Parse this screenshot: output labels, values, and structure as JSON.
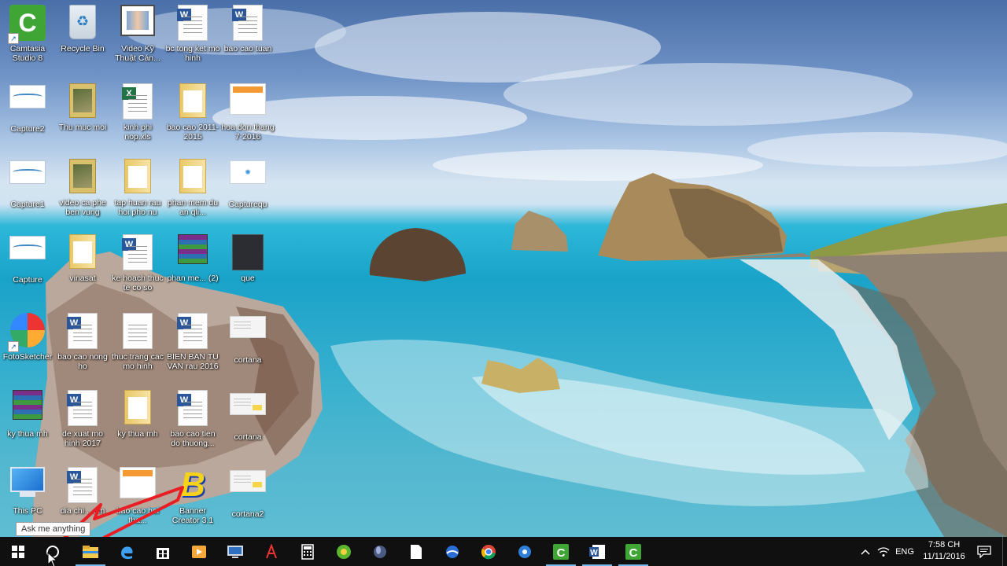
{
  "desktop": {
    "icons": [
      {
        "id": "camtasia",
        "label": "Camtasia Studio 8"
      },
      {
        "id": "recycle",
        "label": "Recycle Bin"
      },
      {
        "id": "video-ky",
        "label": "Video Kỹ Thuật Cán..."
      },
      {
        "id": "bc-tong-ket",
        "label": "bc tong ket mo hinh"
      },
      {
        "id": "bao-cao-tuan",
        "label": "bao cao tuan"
      },
      {
        "id": "capture2",
        "label": "Capture2"
      },
      {
        "id": "thu-muc-moi",
        "label": "Thu muc moi"
      },
      {
        "id": "kinh-phi",
        "label": "kinh phi nop.xls"
      },
      {
        "id": "bao-cao-2011",
        "label": "bao cao 2011-2015"
      },
      {
        "id": "hoa-don",
        "label": "hoa don thang 7-2016"
      },
      {
        "id": "capture1",
        "label": "Capture1"
      },
      {
        "id": "video-ca-phe",
        "label": "video ca phe ben vung"
      },
      {
        "id": "tap-huan",
        "label": "tap huan rau hoi pho nu"
      },
      {
        "id": "phan-mem-du-an",
        "label": "phan mem du an qli..."
      },
      {
        "id": "capturequ",
        "label": "Capturequ"
      },
      {
        "id": "capture",
        "label": "Capture"
      },
      {
        "id": "vinasat",
        "label": "vinasat"
      },
      {
        "id": "ke-hoach",
        "label": "ke hoach thuc te co so"
      },
      {
        "id": "phan-me-2",
        "label": "phan me... (2)"
      },
      {
        "id": "que",
        "label": "que"
      },
      {
        "id": "fotosketcher",
        "label": "FotoSketcher"
      },
      {
        "id": "bao-cao-nong-ho",
        "label": "bao cao nong ho"
      },
      {
        "id": "thuc-trang",
        "label": "thuc trang cac mo hinh"
      },
      {
        "id": "bien-ban",
        "label": "BIEN BAN TU VAN rau 2016"
      },
      {
        "id": "cortana-1",
        "label": "cortana"
      },
      {
        "id": "ky-thua-mh-1",
        "label": "ky thua mh"
      },
      {
        "id": "de-xuat",
        "label": "de xuat mo hinh 2017"
      },
      {
        "id": "ky-thua-mh-2",
        "label": "ky thua mh"
      },
      {
        "id": "bao-cao-tien-do",
        "label": "bao cao tien do thuong..."
      },
      {
        "id": "cortana-2",
        "label": "cortana"
      },
      {
        "id": "this-pc",
        "label": "This PC"
      },
      {
        "id": "dia-chi",
        "label": "dia chi ...em"
      },
      {
        "id": "bao-cao-hoi",
        "label": "bao cao hoi tha..."
      },
      {
        "id": "banner-creator",
        "label": "Banner Creator 3.1"
      },
      {
        "id": "cortana2",
        "label": "cortana2"
      }
    ]
  },
  "search_tooltip": "Ask me anything",
  "taskbar": {
    "start_icon": "windows-logo-icon",
    "search_icon": "cortana-circle-icon",
    "apps": [
      {
        "name": "file-explorer-icon",
        "active": true
      },
      {
        "name": "edge-icon",
        "active": false
      },
      {
        "name": "store-icon",
        "active": false
      },
      {
        "name": "media-player-icon",
        "active": false
      },
      {
        "name": "remote-desktop-icon",
        "active": false
      },
      {
        "name": "acrobat-icon",
        "active": false
      },
      {
        "name": "calculator-icon",
        "active": false
      },
      {
        "name": "green-app-icon",
        "active": false
      },
      {
        "name": "globe-app-icon",
        "active": false
      },
      {
        "name": "notepad-icon",
        "active": false
      },
      {
        "name": "browser-icon",
        "active": false
      },
      {
        "name": "chrome-icon",
        "active": false
      },
      {
        "name": "media-center-icon",
        "active": false
      },
      {
        "name": "camtasia-recorder-icon",
        "active": true
      },
      {
        "name": "word-icon",
        "active": true
      },
      {
        "name": "camtasia-studio-icon",
        "active": true
      }
    ],
    "tray": {
      "language": "ENG",
      "time": "7:58 CH",
      "date": "11/11/2016"
    }
  },
  "colors": {
    "taskbar": "#101010",
    "annotation_arrow": "#e81e24",
    "active_indicator": "#76b9ed"
  }
}
